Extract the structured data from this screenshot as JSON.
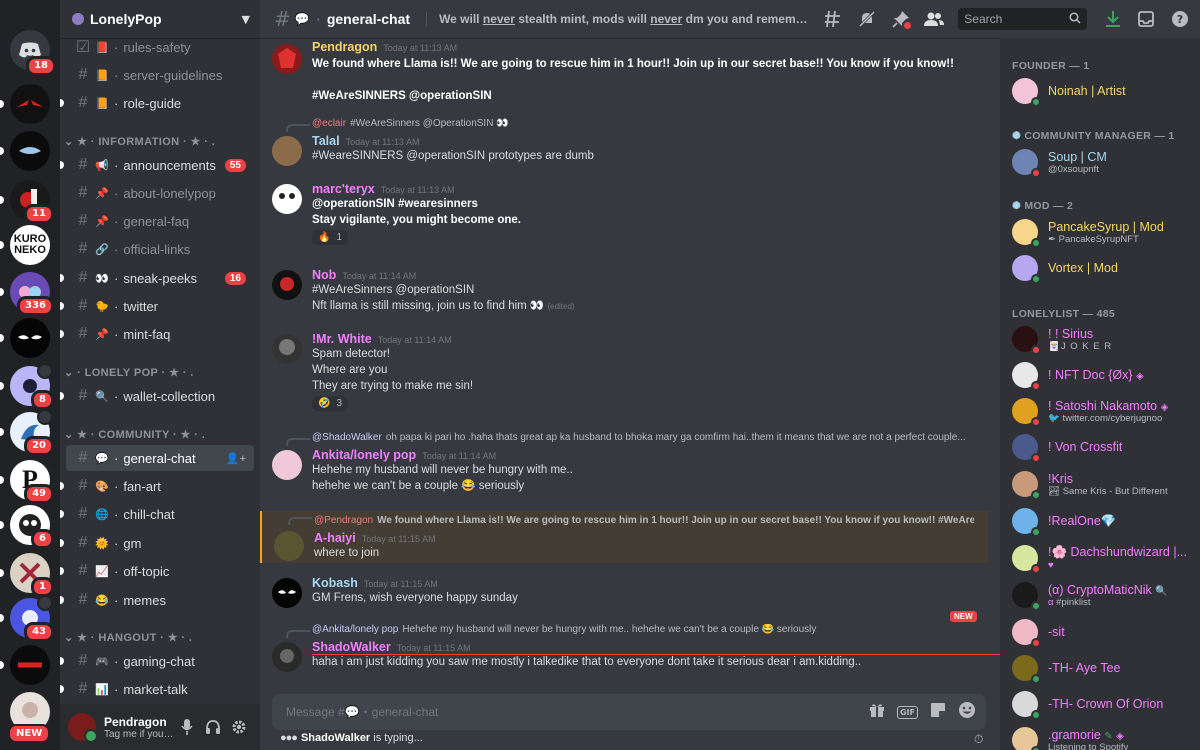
{
  "colors": {
    "founder": "#f5d565",
    "cm": "#a8d8f0",
    "mod": "#f5d565",
    "member": "#f47fff",
    "online": "#3ba55d",
    "dnd": "#ed4245",
    "accent": "#5865f2"
  },
  "rail": {
    "home_badge": "18",
    "servers": [
      {
        "id": "s1",
        "badge": ""
      },
      {
        "id": "s2",
        "badge": ""
      },
      {
        "id": "s3",
        "badge": "11"
      },
      {
        "id": "s4",
        "label": "KURO NEKO",
        "badge": ""
      },
      {
        "id": "s5",
        "badge": "336"
      },
      {
        "id": "s6",
        "badge": ""
      },
      {
        "id": "s7",
        "badge": "8"
      },
      {
        "id": "s8",
        "badge": "20"
      },
      {
        "id": "s9",
        "label": "P",
        "badge": "49"
      },
      {
        "id": "s10",
        "badge": "6"
      },
      {
        "id": "s11",
        "badge": "1"
      },
      {
        "id": "s12",
        "badge": "43"
      },
      {
        "id": "s13",
        "badge": ""
      }
    ],
    "new_label": "NEW"
  },
  "guild": {
    "name": "LonelyPop"
  },
  "channels": {
    "rules": "rules-safety",
    "guidelines": "server-guidelines",
    "role_guide": "role-guide",
    "cat_information": "★ · INFORMATION · ★ · .",
    "announcements": "announcements",
    "announcements_count": "55",
    "about": "about-lonelypop",
    "faq": "general-faq",
    "links": "official-links",
    "sneak": "sneak-peeks",
    "sneak_count": "16",
    "twitter": "twitter",
    "mintfaq": "mint-faq",
    "cat_lonelypop": "· LONELY POP · ★ · .",
    "wallet": "wallet-collection",
    "cat_community": "★ · COMMUNITY · ★ · .",
    "general": "general-chat",
    "fanart": "fan-art",
    "chill": "chill-chat",
    "gm": "gm",
    "offtopic": "off-topic",
    "memes": "memes",
    "cat_hangout": "★ · HANGOUT · ★ · .",
    "gaming": "gaming-chat",
    "market": "market-talk"
  },
  "user": {
    "name": "Pendragon",
    "status": "Tag me if you h..."
  },
  "topbar": {
    "channel": "general-chat",
    "topic_a": "We will ",
    "topic_b": "never",
    "topic_c": " stealth mint, mods will ",
    "topic_d": "never",
    "topic_e": " dm you and remember to only use ...",
    "search_placeholder": "Search"
  },
  "messages": {
    "m1": {
      "author": "Pendragon",
      "time": "Today at 11:13 AM",
      "l1": "We found where Llama is!! We are going to rescue him in 1 hour!! Join up in our secret base!! You know if you know!!",
      "l2": "#WeAreSINNERS @operationSIN"
    },
    "m2": {
      "reply_name": "@eclair",
      "reply_text": "#WeAreSinners @OperationSIN 👀",
      "author": "Talal",
      "time": "Today at 11:13 AM",
      "l1": "#WeareSINNERS @operationSIN prototypes are dumb"
    },
    "m3": {
      "author": "marc'teryx",
      "time": "Today at 11:13 AM",
      "l1": "@operationSIN #wearesinners",
      "l2": "Stay vigilante, you might become one.",
      "react_emoji": "🔥",
      "react_count": "1"
    },
    "m4": {
      "author": "Nob",
      "time": "Today at 11:14 AM",
      "l1": "#WeAreSinners @operationSIN",
      "l2": "Nft llama is still missing, join us to find him 👀",
      "edited": "(edited)"
    },
    "m5": {
      "author": "!Mr. White",
      "time": "Today at 11:14 AM",
      "l1": "Spam detector!",
      "l2": "Where are you",
      "l3": "They are trying to make me sin!",
      "react_emoji": "🤣",
      "react_count": "3"
    },
    "m6": {
      "reply_name": "@ShadoWalker",
      "reply_text": "oh papa ki pari ho .haha thats great ap ka husband to bhoka mary ga comfirm hai..them it means that we are not a perfect couple...",
      "author": "Ankita/lonely pop",
      "time": "Today at 11:14 AM",
      "l1": "Hehehe my husband will never be hungry with me..",
      "l2": "hehehe we can't be a couple 😂 seriously"
    },
    "m7": {
      "reply_name": "@Pendragon",
      "reply_text": "We found where Llama is!! We are going to rescue him in 1 hour!! Join up in our secret base!! You know if you know!!  #WeAreSi...",
      "author": "A-haiyi",
      "time": "Today at 11:15 AM",
      "l1": "where to join"
    },
    "m8": {
      "author": "Kobash",
      "time": "Today at 11:15 AM",
      "l1": "GM Frens, wish everyone happy sunday"
    },
    "m9": {
      "reply_name": "@Ankita/lonely pop",
      "reply_text": "Hehehe my husband will never be hungry with me.. hehehe we can't be a couple 😂 seriously",
      "author": "ShadoWalker",
      "time": "Today at 11:15 AM",
      "l1": "haha i am just kidding you saw me mostly i talkedike that to everyone dont take it serious dear i am.kidding.."
    }
  },
  "new_marker": "NEW",
  "composer": {
    "placeholder": "Message #💬・general-chat",
    "gif": "GIF"
  },
  "typing": {
    "who": "ShadoWalker",
    "text": " is typing..."
  },
  "members": {
    "g_founder": "FOUNDER — 1",
    "g_cm": "COMMUNITY MANAGER — 1",
    "g_mod": "MOD — 2",
    "g_list": "LONELYLIST — 485",
    "noinah": "Noinah | Artist",
    "soup": "Soup | CM",
    "soup_sub": "@0xsoupnft",
    "pancake": "PancakeSyrup | Mod",
    "pancake_sub": "PancakeSyrupNFT",
    "vortex": "Vortex | Mod",
    "sirius": "! ! Sirius",
    "sirius_sub": "J O K E R",
    "nftdoc": "! NFT Doc {Øx}",
    "satoshi": "! Satoshi Nakamoto",
    "satoshi_sub": "twitter.com/cyberjugnoo",
    "von": "! Von Crossfit",
    "kris": "!Kris",
    "kris_sub": "Same Kris - But Different",
    "realone": "!RealOne💎",
    "dachs": "!🌸 Dachshundwizard |...",
    "crypto": "(α) CryptoMaticNik",
    "crypto_sub": "#pinklist",
    "sit": "-sit",
    "ayetee": "-TH- Aye Tee",
    "crown": "-TH- Crown Of Orion",
    "gramorie": ".gramorie",
    "gramorie_sub": "Listening to Spotify"
  }
}
